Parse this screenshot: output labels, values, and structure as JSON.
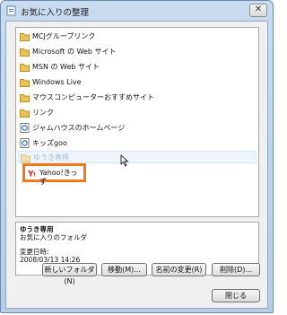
{
  "window": {
    "title": "お気に入りの整理",
    "close_glyph": "✕"
  },
  "tree": {
    "items": [
      {
        "label": "MCJグループリンク",
        "icon": "folder-icon"
      },
      {
        "label": "Microsoft の Web サイト",
        "icon": "folder-icon"
      },
      {
        "label": "MSN の Web サイト",
        "icon": "folder-icon"
      },
      {
        "label": "Windows Live",
        "icon": "folder-icon"
      },
      {
        "label": "マウスコンピューターおすすめサイト",
        "icon": "folder-icon"
      },
      {
        "label": "リンク",
        "icon": "folder-icon"
      },
      {
        "label": "ジャムハウスのホームページ",
        "icon": "ie-page-icon"
      },
      {
        "label": "キッズgoo",
        "icon": "ie-page-icon"
      },
      {
        "label": "ゆうき専用",
        "icon": "folder-icon"
      }
    ],
    "dragged_item": {
      "label": "Yahoo!きっず",
      "icon": "yahoo-kids-icon"
    }
  },
  "info": {
    "name": "ゆうき専用",
    "type": "お気に入りのフォルダ",
    "modified_label": "変更日時:",
    "modified_value": "2008/03/13 14:26"
  },
  "buttons": {
    "new_folder": "新しいフォルダ(N)",
    "move": "移動(M)...",
    "rename": "名前の変更(R)",
    "delete": "削除(D)...",
    "close": "閉じる"
  },
  "colors": {
    "folder": "#e8c25a",
    "highlight_border": "#f07a13",
    "selected_text": "#9fbad6"
  }
}
